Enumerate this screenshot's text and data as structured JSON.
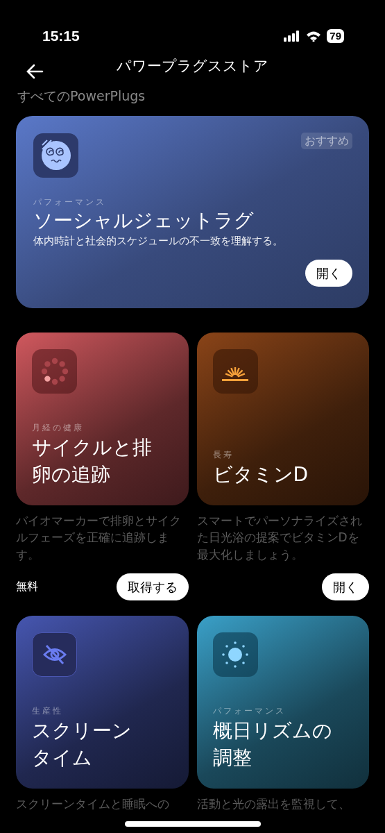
{
  "status_bar": {
    "time": "15:15",
    "battery": "79"
  },
  "header": {
    "title": "パワープラグスストア"
  },
  "section_title": "すべてのPowerPlugs",
  "featured": {
    "kind": "dizzy",
    "badge": "おすすめ",
    "category": "パフォーマンス",
    "title": "ソーシャルジェットラグ",
    "description": "体内時計と社会的スケジュールの不一致を理解する。",
    "button": "開く",
    "color": "#5a78c8"
  },
  "plugs": [
    {
      "kind": "dots",
      "color": "#d0585e",
      "category": "月経の健康",
      "title_lines": [
        "サイクルと排",
        "卵の追跡"
      ],
      "description": "バイオマーカーで排卵とサイクルフェーズを正確に追跡します。",
      "price": "無料",
      "button": "取得する"
    },
    {
      "kind": "sunrise",
      "color": "#8a4418",
      "category": "長寿",
      "title_lines": [
        "ビタミンD"
      ],
      "description": "スマートでパーソナライズされた日光浴の提案でビタミンDを最大化しましょう。",
      "button": "開く"
    },
    {
      "kind": "eye-off",
      "color": "#4656b0",
      "category": "生産性",
      "title_lines": [
        "スクリーン",
        "タイム"
      ],
      "description": "スクリーンタイムと睡眠への"
    },
    {
      "kind": "sun",
      "color": "#3aa0c8",
      "category": "パフォーマンス",
      "title_lines": [
        "概日リズムの",
        "調整"
      ],
      "description": "活動と光の露出を監視して、"
    }
  ]
}
